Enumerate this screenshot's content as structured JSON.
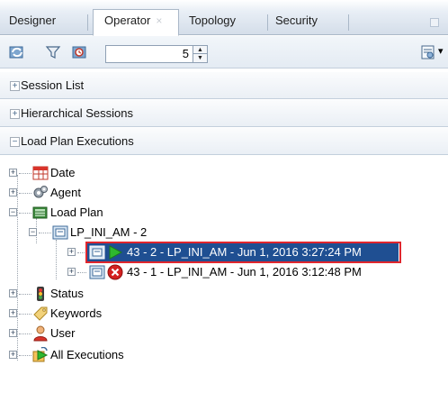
{
  "tabs": [
    {
      "label": "Designer",
      "active": false
    },
    {
      "label": "Operator",
      "active": true,
      "close": "×"
    },
    {
      "label": "Topology",
      "active": false
    },
    {
      "label": "Security",
      "active": false
    }
  ],
  "toolbar": {
    "icons": [
      "refresh-icon",
      "filter-icon",
      "auto-refresh-icon"
    ],
    "spinner_value": "5",
    "spinner_up": "▲",
    "spinner_down": "▼",
    "view_menu_icon": "view-options-icon",
    "view_menu_caret": "▾"
  },
  "sections": [
    {
      "label": "Session List",
      "sign": "+"
    },
    {
      "label": "Hierarchical Sessions",
      "sign": "+"
    },
    {
      "label": "Load Plan Executions",
      "sign": "−"
    }
  ],
  "tree": {
    "date": "Date",
    "agent": "Agent",
    "load_plan": "Load Plan",
    "lp_node": "LP_INI_AM - 2",
    "exec_running": "43 - 2 - LP_INI_AM - Jun 1, 2016 3:27:24 PM",
    "exec_error": "43 - 1 - LP_INI_AM - Jun 1, 2016 3:12:48 PM",
    "status": "Status",
    "keywords": "Keywords",
    "user": "User",
    "all_executions": "All Executions",
    "expand_plus": "+",
    "expand_minus": "−"
  },
  "colors": {
    "selection": "#1f4f92",
    "highlight_border": "#e0262d",
    "running": "#2eb82e",
    "error": "#d42020"
  }
}
